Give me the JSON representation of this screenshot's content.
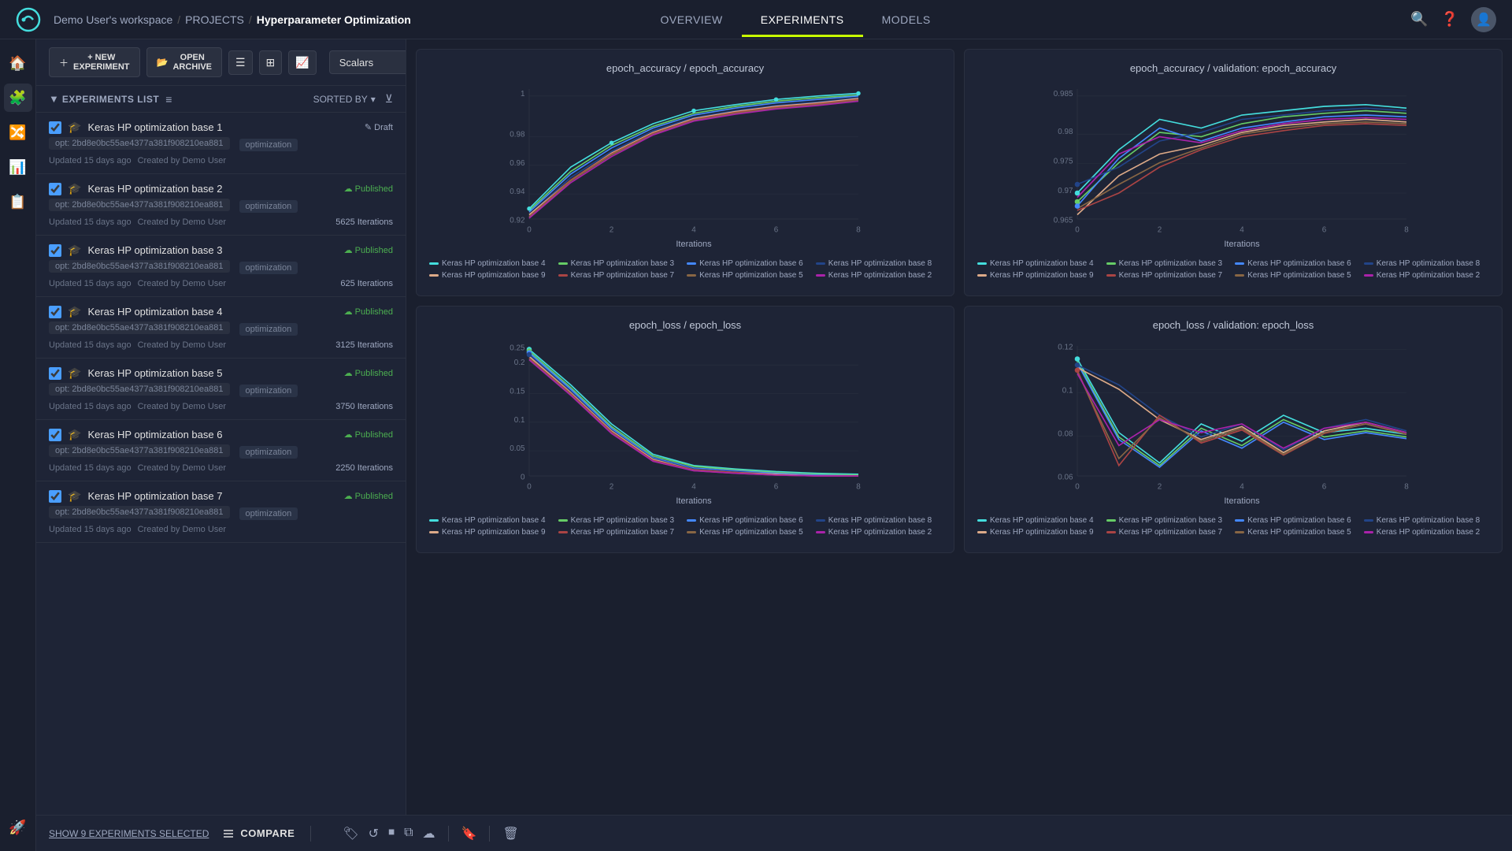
{
  "app": {
    "logo": "C",
    "breadcrumb": {
      "workspace": "Demo User's workspace",
      "sep1": "/",
      "projects": "PROJECTS",
      "sep2": "/",
      "current": "Hyperparameter Optimization"
    },
    "nav_tabs": [
      {
        "id": "overview",
        "label": "OVERVIEW",
        "active": false
      },
      {
        "id": "experiments",
        "label": "EXPERIMENTS",
        "active": true
      },
      {
        "id": "models",
        "label": "MODELS",
        "active": false
      }
    ]
  },
  "toolbar": {
    "new_experiment": "+ NEW EXPERIMENT",
    "open_archive": "OPEN ARCHIVE",
    "scalars_label": "Scalars",
    "scalars_arrow": "▾"
  },
  "exp_list": {
    "header": "EXPERIMENTS LIST",
    "sorted_by": "SORTED BY",
    "experiments": [
      {
        "name": "Keras HP optimization base 1",
        "opt": "opt: 2bd8e0bc55ae4377a381f908210ea881",
        "tag": "optimization",
        "status": "Draft",
        "status_type": "draft",
        "updated": "Updated 15 days ago",
        "created_by": "Created by Demo User",
        "iterations": ""
      },
      {
        "name": "Keras HP optimization base 2",
        "opt": "opt: 2bd8e0bc55ae4377a381f908210ea881",
        "tag": "optimization",
        "status": "Published",
        "status_type": "published",
        "updated": "Updated 15 days ago",
        "created_by": "Created by Demo User",
        "iterations": "5625 Iterations"
      },
      {
        "name": "Keras HP optimization base 3",
        "opt": "opt: 2bd8e0bc55ae4377a381f908210ea881",
        "tag": "optimization",
        "status": "Published",
        "status_type": "published",
        "updated": "Updated 15 days ago",
        "created_by": "Created by Demo User",
        "iterations": "625 Iterations"
      },
      {
        "name": "Keras HP optimization base 4",
        "opt": "opt: 2bd8e0bc55ae4377a381f908210ea881",
        "tag": "optimization",
        "status": "Published",
        "status_type": "published",
        "updated": "Updated 15 days ago",
        "created_by": "Created by Demo User",
        "iterations": "3125 Iterations"
      },
      {
        "name": "Keras HP optimization base 5",
        "opt": "opt: 2bd8e0bc55ae4377a381f908210ea881",
        "tag": "optimization",
        "status": "Published",
        "status_type": "published",
        "updated": "Updated 15 days ago",
        "created_by": "Created by Demo User",
        "iterations": "3750 Iterations"
      },
      {
        "name": "Keras HP optimization base 6",
        "opt": "opt: 2bd8e0bc55ae4377a381f908210ea881",
        "tag": "optimization",
        "status": "Published",
        "status_type": "published",
        "updated": "Updated 15 days ago",
        "created_by": "Created by Demo User",
        "iterations": "2250 Iterations"
      },
      {
        "name": "Keras HP optimization base 7",
        "opt": "opt: 2bd8e0bc55ae4377a381f908210ea881",
        "tag": "optimization",
        "status": "Published",
        "status_type": "published",
        "updated": "Updated 15 days ago",
        "created_by": "Created by Demo User",
        "iterations": ""
      }
    ]
  },
  "charts": {
    "top_left": {
      "title": "epoch_accuracy / epoch_accuracy",
      "y_min": 0.92,
      "y_max": 1,
      "x_max": 8,
      "y_labels": [
        "0.92",
        "0.94",
        "0.96",
        "0.98",
        "1"
      ]
    },
    "top_right": {
      "title": "epoch_accuracy / validation: epoch_accuracy",
      "y_min": 0.965,
      "y_max": 0.985,
      "x_max": 8
    },
    "bottom_left": {
      "title": "epoch_loss / epoch_loss",
      "y_min": 0,
      "y_max": 0.25,
      "x_max": 8,
      "y_labels": [
        "0",
        "0.05",
        "0.1",
        "0.15",
        "0.2",
        "0.25"
      ]
    },
    "bottom_right": {
      "title": "epoch_loss / validation: epoch_loss",
      "y_min": 0.06,
      "y_max": 0.12,
      "x_max": 8
    }
  },
  "legend": {
    "items": [
      {
        "label": "Keras HP optimization base 4",
        "color": "#4dd"
      },
      {
        "label": "Keras HP optimization base 3",
        "color": "#6c6"
      },
      {
        "label": "Keras HP optimization base 6",
        "color": "#48f"
      },
      {
        "label": "Keras HP optimization base 8",
        "color": "#248"
      },
      {
        "label": "Keras HP optimization base 9",
        "color": "#da8"
      },
      {
        "label": "Keras HP optimization base 7",
        "color": "#a44"
      },
      {
        "label": "Keras HP optimization base 5",
        "color": "#864"
      },
      {
        "label": "Keras HP optimization base 2",
        "color": "#a2a"
      }
    ]
  },
  "bottom_bar": {
    "show_selected": "SHOW 9 EXPERIMENTS SELECTED",
    "compare": "COMPARE"
  },
  "sidebar_icons": [
    "🏠",
    "🧩",
    "🔀",
    "📊",
    "📋",
    "🚀"
  ]
}
